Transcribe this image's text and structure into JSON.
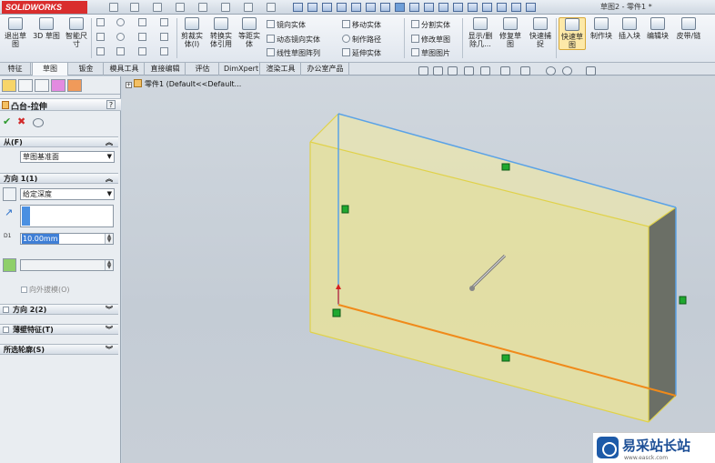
{
  "app": {
    "logo": "SOLIDWORKS",
    "window_title": "草图2 - 零件1 *"
  },
  "ribbon": {
    "big_buttons": [
      {
        "label": "退出草\n图",
        "icon": "exit-sketch-icon"
      },
      {
        "label": "3D 草图",
        "icon": "3d-sketch-icon"
      },
      {
        "label": "智能尺\n寸",
        "icon": "smart-dimension-icon"
      },
      {
        "label": "剪裁实\n体(I)",
        "icon": "trim-icon"
      },
      {
        "label": "转换实\n体引用",
        "icon": "convert-entities-icon"
      },
      {
        "label": "等距实\n体",
        "icon": "offset-icon"
      },
      {
        "label": "显示/删\n除几...",
        "icon": "display-relations-icon"
      },
      {
        "label": "修复草\n图",
        "icon": "repair-sketch-icon"
      },
      {
        "label": "快速捕\n捉",
        "icon": "quick-snaps-icon"
      },
      {
        "label": "快速草\n图",
        "icon": "rapid-sketch-icon"
      },
      {
        "label": "制作块",
        "icon": "make-block-icon"
      },
      {
        "label": "插入块",
        "icon": "insert-block-icon"
      },
      {
        "label": "编辑块",
        "icon": "edit-block-icon"
      },
      {
        "label": "皮带/链",
        "icon": "belt-chain-icon"
      }
    ],
    "small_items": [
      {
        "label": "镜向实体",
        "icon": "mirror-icon"
      },
      {
        "label": "动态镜向实体",
        "icon": "dynamic-mirror-icon"
      },
      {
        "label": "线性草图阵列",
        "icon": "linear-pattern-icon"
      },
      {
        "label": "移动实体",
        "icon": "move-entities-icon"
      },
      {
        "label": "制作路径",
        "icon": "make-path-icon"
      },
      {
        "label": "延伸实体",
        "icon": "extend-icon"
      },
      {
        "label": "分割实体",
        "icon": "split-icon"
      },
      {
        "label": "修改草图",
        "icon": "modify-sketch-icon"
      },
      {
        "label": "草图图片",
        "icon": "sketch-picture-icon"
      }
    ]
  },
  "tabs": [
    {
      "label": "特征",
      "active": false
    },
    {
      "label": "草图",
      "active": true
    },
    {
      "label": "钣金",
      "active": false
    },
    {
      "label": "模具工具",
      "active": false
    },
    {
      "label": "直接编辑",
      "active": false
    },
    {
      "label": "评估",
      "active": false
    },
    {
      "label": "DimXpert",
      "active": false
    },
    {
      "label": "渲染工具",
      "active": false
    },
    {
      "label": "办公室产品",
      "active": false
    }
  ],
  "property_manager": {
    "title": "凸台-拉伸",
    "help": "?",
    "ok_symbol": "✔",
    "cancel_symbol": "✖",
    "from": {
      "header": "从(F)",
      "value": "草图基准面"
    },
    "direction1": {
      "header": "方向 1(1)",
      "end_condition": "给定深度",
      "depth": "10.00mm",
      "depth_prefix": "D1",
      "draft_label": "向外拔模(O)"
    },
    "direction2": {
      "header": "方向 2(2)"
    },
    "thin": {
      "header": "薄壁特征(T)"
    },
    "contours": {
      "header": "所选轮廓(S)"
    }
  },
  "viewport": {
    "tree_label": "零件1  (Default<<Default...",
    "colors": {
      "face": "#e8e3a2",
      "edge_selected": "#f08a1a",
      "edge_blue": "#5aa2e6",
      "side_face": "#6c7066"
    }
  },
  "watermark": {
    "text": "易采站长站",
    "url": "www.easck.com"
  }
}
